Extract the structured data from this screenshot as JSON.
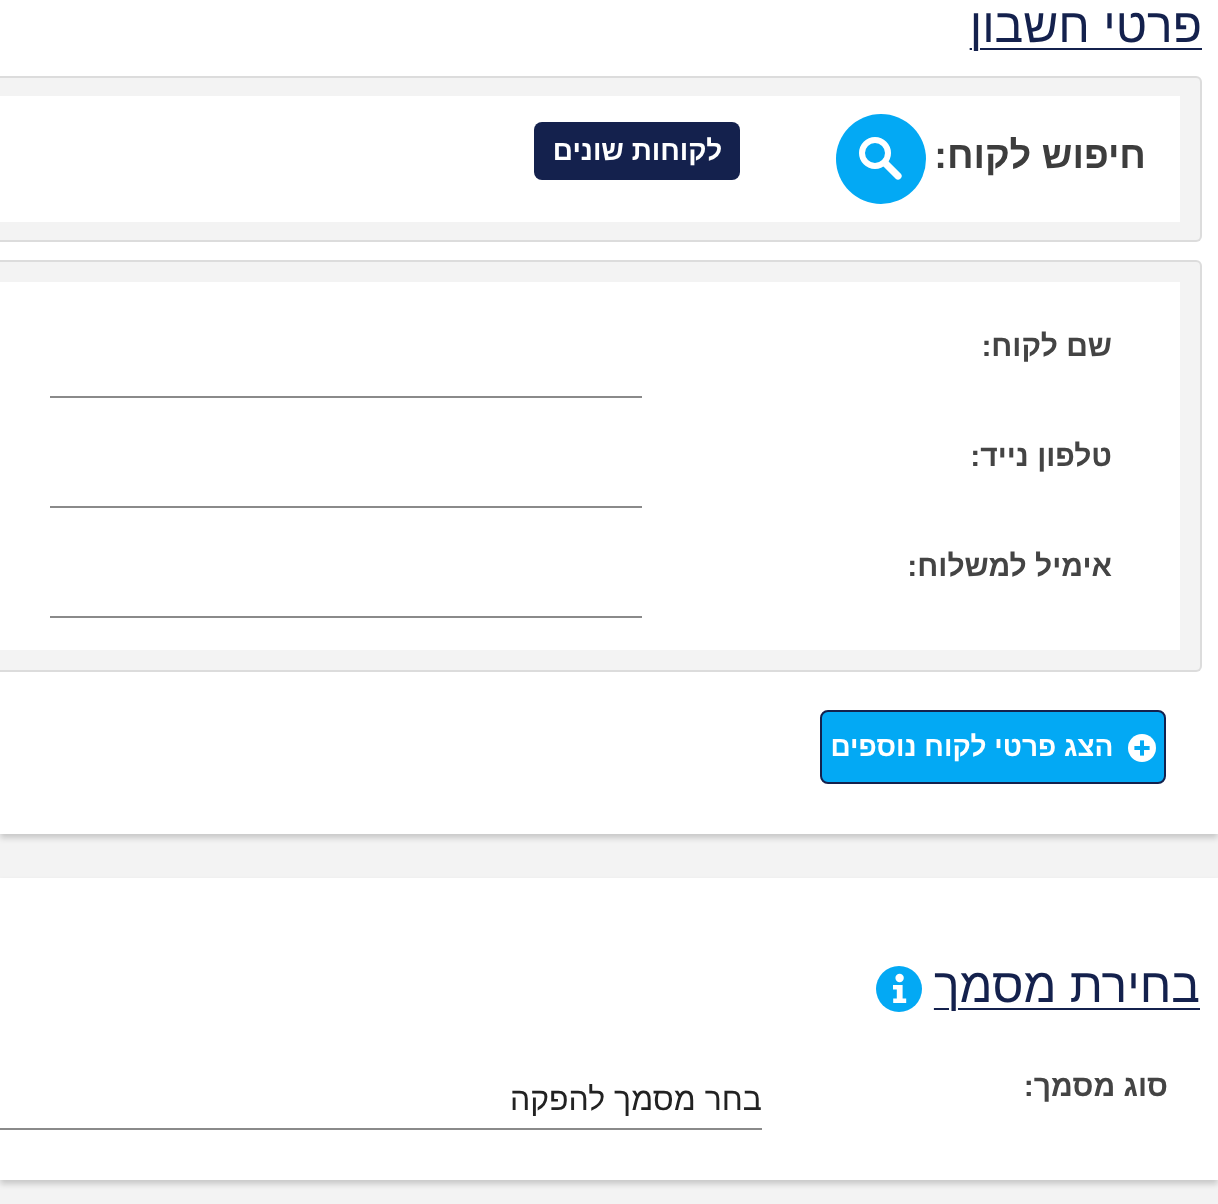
{
  "page_title": "פרטי חשבון",
  "customer_search": {
    "label": "חיפוש לקוח:",
    "badge": "לקוחות שונים"
  },
  "customer_fields": [
    {
      "label": "שם לקוח:"
    },
    {
      "label": "טלפון נייד:"
    },
    {
      "label": "אימיל למשלוח:"
    }
  ],
  "more_details_button": "הצג פרטי לקוח נוספים",
  "document_section": {
    "title": "בחירת מסמך",
    "fields": [
      {
        "label": "סוג מסמך:",
        "value": "בחר מסמך להפקה"
      }
    ]
  }
}
